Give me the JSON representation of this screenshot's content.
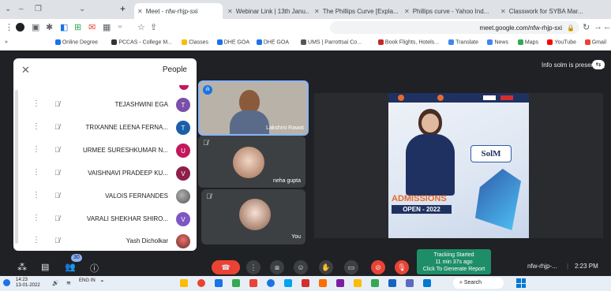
{
  "tabs": [
    {
      "label": "Classwork for SYBA Mar...",
      "active": false
    },
    {
      "label": "Phillips curve - Yahoo Ind...",
      "active": false
    },
    {
      "label": "The Phillips Curve [Expla...",
      "active": false
    },
    {
      "label": "Webinar Link | 13th Janu...",
      "active": false
    },
    {
      "label": "Meet - nfw-rhjp-sxi",
      "active": true
    }
  ],
  "address": {
    "url": "meet.google.com/nfw-rhjp-sxi"
  },
  "bookmarks": [
    "Gmail",
    "YouTube",
    "Maps",
    "News",
    "Translate",
    "Book Flights, Hotels...",
    "UMS | Parrottsai Co...",
    "DHE GOA",
    "DHE GOA",
    "Classes",
    "PCCAS - College M...",
    "Online Degree"
  ],
  "meet": {
    "presenting_text": "Info solm is presenting",
    "people_title": "People",
    "participants": [
      {
        "name": "TEJASHWINI EGA",
        "initial": "T",
        "color": "#7b4fa8"
      },
      {
        "name": "TRIXANNE LEENA FERNA...",
        "initial": "T",
        "color": "#1a5fa8"
      },
      {
        "name": "URMEE SURESHKUMAR N...",
        "initial": "U",
        "color": "#c2185b"
      },
      {
        "name": "VAISHNAVI PRADEEP KU...",
        "initial": "V",
        "color": "#8e1f4a"
      },
      {
        "name": "VALOIS FERNANDES",
        "initial": "",
        "color": "#6d6d6d"
      },
      {
        "name": "VARALI SHEKHAR SHIRO...",
        "initial": "V",
        "color": "#7e57c2"
      },
      {
        "name": "Yash Dicholkar",
        "initial": "",
        "color": "#8c3a2a"
      }
    ],
    "tiles": [
      {
        "name": "Lakshmi Rawat"
      },
      {
        "name": "neha gupta"
      },
      {
        "name": "You"
      }
    ],
    "meeting_time": "2:23 PM",
    "meeting_code": "nfw-rhjp-...",
    "tracking": {
      "line1": "Tracking Started",
      "line2": "11 min 37s ago",
      "line3": "Click To Generate Report"
    },
    "participant_count": "30"
  },
  "slide": {
    "title": "SolM",
    "admissions_line1": "ADMISSIONS",
    "admissions_line2": "OPEN - 2022",
    "brand_colors": {
      "navy": "#1f3160",
      "blue": "#2f5aa8",
      "orange": "#e86b2b"
    }
  },
  "taskbar": {
    "search": "Search",
    "time": "14:23",
    "date": "13-01-2022",
    "lang": "ENG IN"
  }
}
